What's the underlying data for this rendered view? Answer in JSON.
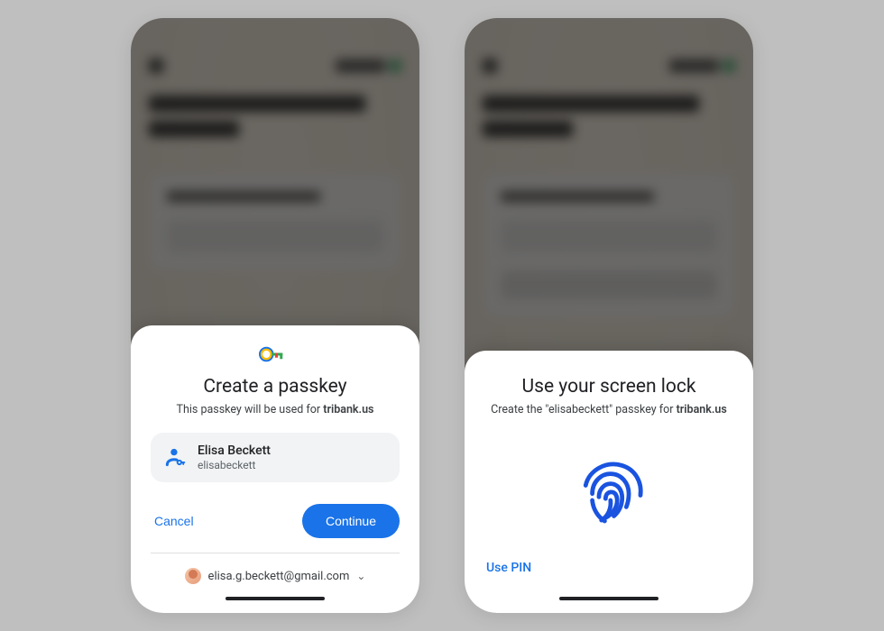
{
  "phone1": {
    "sheet_title": "Create a passkey",
    "sheet_sub_prefix": "This passkey will be used for ",
    "domain": "tribank.us",
    "account": {
      "name": "Elisa Beckett",
      "username": "elisabeckett"
    },
    "cancel_label": "Cancel",
    "continue_label": "Continue",
    "email": "elisa.g.beckett@gmail.com"
  },
  "phone2": {
    "sheet_title": "Use your screen lock",
    "sheet_sub_prefix": "Create the \"elisabeckett\" passkey for ",
    "domain": "tribank.us",
    "use_pin_label": "Use PIN"
  }
}
